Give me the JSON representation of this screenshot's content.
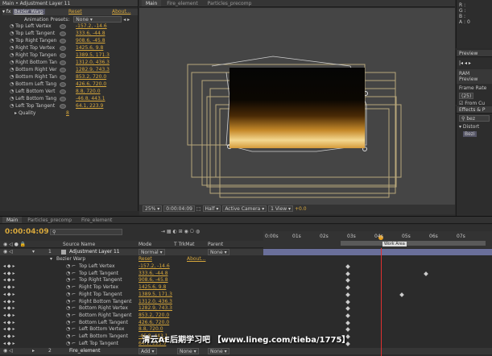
{
  "effect_controls": {
    "title": "Main • Adjustment Layer 11",
    "effect_name": "Bezier Warp",
    "reset": "Reset",
    "about": "About...",
    "presets_label": "Animation Presets:",
    "presets_value": "None",
    "props": [
      {
        "name": "Top Left Vertex",
        "value": "-157.2, -14.6"
      },
      {
        "name": "Top Left Tangent",
        "value": "333.6, -44.8"
      },
      {
        "name": "Top Right Tangen",
        "value": "908.6, -45.8"
      },
      {
        "name": "Right Top Vertex",
        "value": "1425.6, 9.8"
      },
      {
        "name": "Right Top Tangen",
        "value": "1389.5, 171.3"
      },
      {
        "name": "Right Bottom Tan",
        "value": "1312.0, 436.3"
      },
      {
        "name": "Bottom Right Ver",
        "value": "1282.9, 743.3"
      },
      {
        "name": "Bottom Right Tan",
        "value": "853.2, 720.0"
      },
      {
        "name": "Bottom Left Tang",
        "value": "426.6, 720.0"
      },
      {
        "name": "Left Bottom Vert",
        "value": "8.8, 720.0"
      },
      {
        "name": "Left Bottom Tang",
        "value": "-46.8, 443.1"
      },
      {
        "name": "Left Top Tangent",
        "value": "64.1, 223.9"
      }
    ],
    "quality_label": "Quality",
    "quality_value": "8"
  },
  "comp_viewer": {
    "tabs": [
      "Main",
      "Fire_element",
      "Particles_precomp"
    ],
    "zoom": "25%",
    "timecode": "0:00:04:09",
    "resolution": "Half",
    "camera": "Active Camera",
    "views": "1 View",
    "exposure": "+0.0"
  },
  "info": {
    "r": "R :",
    "g": "G :",
    "b": "B :",
    "a": "A : 0"
  },
  "right_panel": {
    "preview_tab": "Preview",
    "ram_preview": "RAM Preview",
    "frame_rate_label": "Frame Rate",
    "frame_rate_value": "(25)",
    "from_current": "From Cu",
    "effects_tab": "Effects & P",
    "search_value": "bez",
    "distort": "Distort",
    "bezier_item": "Bezi"
  },
  "timeline": {
    "tabs": [
      "Main",
      "Particles_precomp",
      "Fire_element"
    ],
    "timecode": "0:00:04:09",
    "cols": {
      "source": "Source Name",
      "mode": "Mode",
      "trkmat": "T TrkMat",
      "parent": "Parent"
    },
    "ruler": [
      "0:00s",
      "01s",
      "02s",
      "03s",
      "04s",
      "05s",
      "06s",
      "07s"
    ],
    "work_area": "Work Area",
    "layer1": {
      "num": "1",
      "name": "Adjustment Layer 11",
      "mode": "Normal",
      "parent": "None"
    },
    "effect_row": {
      "name": "Bezier Warp",
      "reset": "Reset",
      "about": "About..."
    },
    "layer2": {
      "num": "2",
      "name": "Fire_element",
      "mode": "Add",
      "trkmat": "None",
      "parent": "None"
    },
    "props": [
      {
        "name": "Top Left Vertex",
        "value": "-157.2, -14.6"
      },
      {
        "name": "Top Left Tangent",
        "value": "333.6, -44.8"
      },
      {
        "name": "Top Right Tangent",
        "value": "908.6, -45.8"
      },
      {
        "name": "Right Top Vertex",
        "value": "1425.6, 9.8"
      },
      {
        "name": "Right Top Tangent",
        "value": "1389.5, 171.3"
      },
      {
        "name": "Right Bottom Tangent",
        "value": "1312.0, 436.3"
      },
      {
        "name": "Bottom Right Vertex",
        "value": "1282.9, 743.3"
      },
      {
        "name": "Bottom Right Tangent",
        "value": "853.2, 720.0"
      },
      {
        "name": "Bottom Left Tangent",
        "value": "426.6, 720.0"
      },
      {
        "name": "Left Bottom Vertex",
        "value": "8.8, 720.0"
      },
      {
        "name": "Left Bottom Tangent",
        "value": "-46.8, 443.1"
      },
      {
        "name": "Left Top Tangent",
        "value": "64.1, 223.9"
      }
    ]
  },
  "watermark": "清云AE后期学习吧  【www.lineg.com/tieba/1775】",
  "colors": {
    "accent": "#d8a83c",
    "playhead": "#e03030",
    "layer_label": "#6a6f9a"
  }
}
